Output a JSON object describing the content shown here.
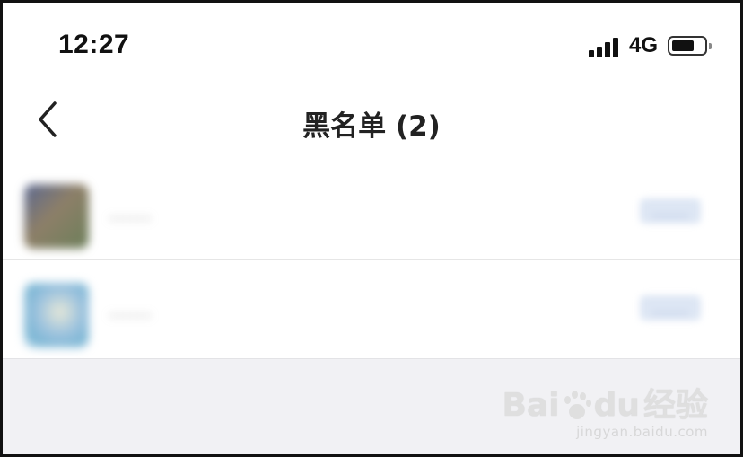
{
  "status_bar": {
    "time": "12:27",
    "network": "4G",
    "signal_icon": "signal-bars-icon",
    "battery_icon": "battery-icon"
  },
  "nav": {
    "back_icon": "chevron-left-icon",
    "title": "黑名单 (2)"
  },
  "list": {
    "items": [
      {
        "name": "……",
        "action": "……"
      },
      {
        "name": "……",
        "action": "……"
      }
    ]
  },
  "watermark": {
    "brand": "Bai  经验",
    "du": "du",
    "url": "jingyan.baidu.com"
  },
  "colors": {
    "background": "#ffffff",
    "bottom_area": "#f1f1f4",
    "action_tint": "#dde6f4",
    "frame_border": "#111111"
  }
}
